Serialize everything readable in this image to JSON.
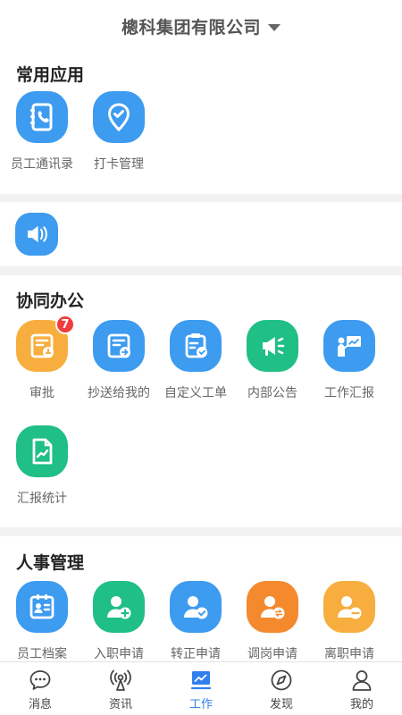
{
  "header": {
    "title": "樬科集团有限公司"
  },
  "common_apps": {
    "title": "常用应用",
    "items": [
      {
        "label": "员工通讯录"
      },
      {
        "label": "打卡管理"
      }
    ]
  },
  "collab": {
    "title": "协同办公",
    "items": [
      {
        "label": "审批",
        "badge": "7"
      },
      {
        "label": "抄送给我的"
      },
      {
        "label": "自定义工单"
      },
      {
        "label": "内部公告"
      },
      {
        "label": "工作汇报"
      },
      {
        "label": "汇报统计"
      }
    ]
  },
  "hr": {
    "title": "人事管理",
    "items": [
      {
        "label": "员工档案"
      },
      {
        "label": "入职申请"
      },
      {
        "label": "转正申请"
      },
      {
        "label": "调岗申请"
      },
      {
        "label": "离职申请"
      }
    ]
  },
  "tabbar": {
    "items": [
      {
        "label": "消息",
        "icon": "chat-bubble-icon"
      },
      {
        "label": "资讯",
        "icon": "broadcast-icon"
      },
      {
        "label": "工作",
        "icon": "work-chart-icon",
        "active": true
      },
      {
        "label": "发现",
        "icon": "compass-icon"
      },
      {
        "label": "我的",
        "icon": "person-icon"
      }
    ]
  },
  "colors": {
    "primary": "#3d9bf0",
    "orange": "#f7ae3e",
    "green": "#1fbf86",
    "deep_orange": "#f5892e",
    "badge": "#f03c3c",
    "active_tab": "#2f80ed"
  }
}
